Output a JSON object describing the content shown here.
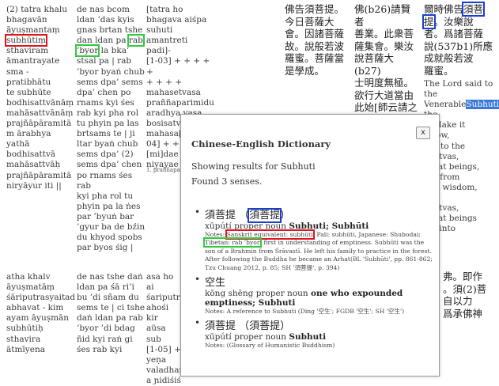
{
  "background_text": {
    "col1_top": [
      {
        "text": "(2) tatra khalu",
        "hl": ""
      },
      {
        "text": "bhagavān",
        "hl": ""
      },
      {
        "text": "āyuṣmantaṃ",
        "hl": ""
      },
      {
        "text": "subhūtiṃ",
        "hl": "red"
      },
      {
        "text": "sthaviram",
        "hl": ""
      },
      {
        "text": "āmantrayate",
        "hl": ""
      },
      {
        "text": "sma - pratibhātu",
        "hl": ""
      },
      {
        "text": "te subhūte",
        "hl": ""
      },
      {
        "text": "bodhisattvānāṃ",
        "hl": ""
      },
      {
        "text": "mahāsattvānāṃ",
        "hl": ""
      },
      {
        "text": "prajñāpāramitā",
        "hl": ""
      },
      {
        "text": "m ārabhya yathā",
        "hl": ""
      },
      {
        "text": "bodhisattvā",
        "hl": ""
      },
      {
        "text": "mahāsattvāḥ",
        "hl": ""
      },
      {
        "text": "prajñāpāramitā",
        "hl": ""
      },
      {
        "text": "niryāyur iti ||",
        "hl": ""
      }
    ],
    "col2_top": [
      {
        "pre": "de nas bcom",
        "hl_text": "",
        "post": ""
      },
      {
        "pre": "ldan ’das kyis",
        "hl_text": "",
        "post": ""
      },
      {
        "pre": "gnas brtan tshe",
        "hl_text": "",
        "post": ""
      },
      {
        "pre": "dan ldan pa ",
        "hl_text": "rab",
        "post": ""
      },
      {
        "pre": "",
        "hl_text": "’byor",
        "post": " la bka’"
      },
      {
        "pre": "stsal pa | rab",
        "hl_text": "",
        "post": ""
      },
      {
        "pre": "’byor byaṅ chub",
        "hl_text": "",
        "post": ""
      },
      {
        "pre": "sems dpa’ sems",
        "hl_text": "",
        "post": ""
      },
      {
        "pre": "dpa’ chen po",
        "hl_text": "",
        "post": ""
      },
      {
        "pre": "rnams kyi śes",
        "hl_text": "",
        "post": ""
      },
      {
        "pre": "rab kyi pha rol",
        "hl_text": "",
        "post": ""
      },
      {
        "pre": "tu phyin pa las",
        "hl_text": "",
        "post": ""
      },
      {
        "pre": "brtsams te | ji",
        "hl_text": "",
        "post": ""
      },
      {
        "pre": "ltar byaṅ chub",
        "hl_text": "",
        "post": ""
      },
      {
        "pre": "sems dpa’ (2)",
        "hl_text": "",
        "post": ""
      },
      {
        "pre": "sems dpa’ chen",
        "hl_text": "",
        "post": ""
      },
      {
        "pre": "po rnams śes rab",
        "hl_text": "",
        "post": ""
      },
      {
        "pre": "kyi pha rol tu",
        "hl_text": "",
        "post": ""
      },
      {
        "pre": "phyin pa la ṅes",
        "hl_text": "",
        "post": ""
      },
      {
        "pre": "par ’byuṅ bar",
        "hl_text": "",
        "post": ""
      },
      {
        "pre": "’gyur ba de bźin",
        "hl_text": "",
        "post": ""
      },
      {
        "pre": "du khyod spobs",
        "hl_text": "",
        "post": ""
      },
      {
        "pre": "par byos śig |",
        "hl_text": "",
        "post": ""
      }
    ],
    "col3_top": "[tatra ho\nbhagava aiśpa\nsuhuti\namantreti padi]-\n[1-03] + + + + +\n+ + + +\nmahasetvasa\npraññaparimidu\naradhya yasa\nbosisatve\nmahasa[\n04] + +\n[mi]dae\nniyayae",
    "col3_foot": "1. praññaparamita",
    "col4_cjk": "佛告須菩提。\n今日菩薩大\n會。因諸菩薩\n故。說般若波\n羅蜜。菩薩當\n是學成。",
    "col5_cjk": "佛(b26)請賢者\n善業。此衆菩\n薩集會。樂汝\n說菩薩大(b27)\n士明度無極。\n欲行大道當由\n此始[師云請之\n以法不以飲食\n(28)也]",
    "col6_cjk_line1_pre": "爾時佛告",
    "col6_cjk_line1_hl": "須菩",
    "col6_cjk_line2_hl": "提",
    "col6_cjk_line2_post": "。汝樂說",
    "col6_cjk_rest": "者。爲諸菩薩\n說(537b1)所應\n成就般若波\n羅蜜。",
    "col6_en_pre": "The Lord said to\nthe Venerable",
    "col6_en_sel": "Subhuti",
    "col6_en_post": ", the\nr: Make it\nr now,\nuti, to the\nisattvas,\ngreat beings,\ning from\nfect wisdom,\nthe\nisattvas,\ngreat beings\nrth into\nect\nom!",
    "bottom_col1": "atha khalv\nāyuṣmatāṃ\nśāriputrasyaitad\nabhavat - kim\nayam āyuṣmān\nsubhūtiḥ\nsthavira\nātmīyena",
    "bottom_col2": "de nas tshe daṅ\nldan pa śā ri’i\nbu ’di sñam du\nsems te | ci tshe\ndaṅ ldan pa rab\n’byor ’di bdag\nñid kyi raṅ gi\nśes rab kyi",
    "bottom_col3": "asa ho ai\nśariputra\nahośi kir\naüsa sub\n[1-05] +\nyeṇa\nvaladhar\na ɲidiśiś",
    "bottom_col6": "弗。即作\n。須(2)菩\n自以力\n爲承佛神"
  },
  "dialog": {
    "close_label": "x",
    "title": "Chinese-English Dictionary",
    "showing_prefix": "Showing results for ",
    "query": "Subhuti",
    "found": "Found 3 senses.",
    "entries": [
      {
        "term_main": "須菩提",
        "term_paren": "須菩提",
        "pinyin": "xūpútí",
        "pos": "proper noun",
        "gloss": "Subhuti; Subhūti",
        "notes_prefix": "Notes: ",
        "notes_hl_red": "Sanskrit equivalent: subhūti",
        "notes_mid": "; Pali: subhūti, Japanese: Shubodai;",
        "notes_hl_green": "Tibetan: rab ’byor",
        "notes_rest": "; first in understanding of emptiness. Subhūti was the son of a Brahmin from Śrāvastī. He left his family to practice in the forest. After following the Buddha he became an Arhat(BL 'Subhūti', pp. 861-862; Tzu Chuang 2012, p. 85; SH '須菩提', p. 394)"
      },
      {
        "term_main": "空生",
        "pinyin": "kōng shēng",
        "pos": "proper noun",
        "gloss": "one who expounded emptiness; Subhuti",
        "notes": "Notes: A reference to Subhuti (Ding '空生'; FGDB '空生'; SH '空生')"
      },
      {
        "term_main": "須菩提",
        "term_paren": "須菩提",
        "pinyin": "xūpútí",
        "pos": "proper noun",
        "gloss": "Subhuti",
        "notes": "Notes: (Glossary of Humanistic Buddhism)"
      }
    ]
  }
}
